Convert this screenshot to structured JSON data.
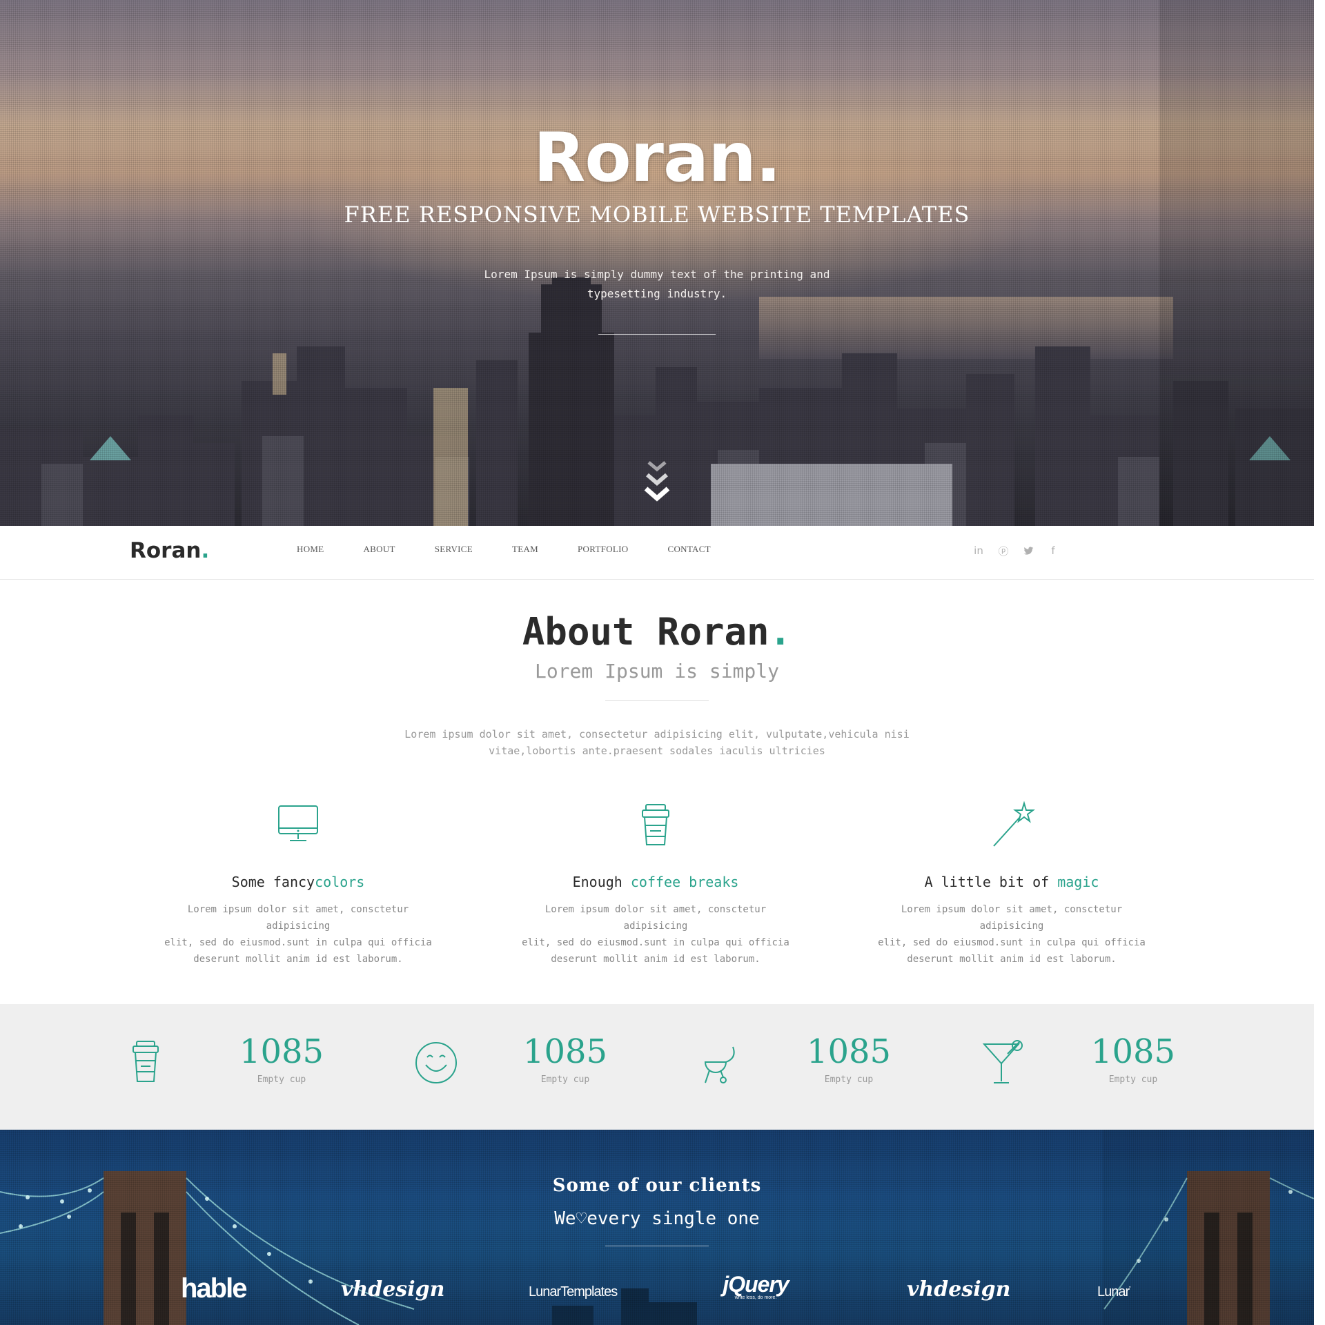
{
  "hero": {
    "title": "Roran",
    "title_dot": ".",
    "subtitle": "FREE RESPONSIVE MOBILE WEBSITE TEMPLATES",
    "text_line1": "Lorem Ipsum is simply dummy text of the printing and",
    "text_line2": "typesetting industry."
  },
  "nav": {
    "logo": "Roran",
    "logo_dot": ".",
    "items": [
      "HOME",
      "ABOUT",
      "SERVICE",
      "TEAM",
      "PORTFOLIO",
      "CONTACT"
    ],
    "social": [
      "linkedin-icon",
      "pinterest-icon",
      "twitter-icon",
      "facebook-icon"
    ]
  },
  "about": {
    "title": "About Roran",
    "title_dot": ".",
    "subtitle": "Lorem Ipsum is simply",
    "text_line1": "Lorem ipsum dolor sit amet, consectetur adipisicing elit, vulputate,vehicula nisi",
    "text_line2": "vitae,lobortis ante.praesent sodales iaculis ultricies",
    "features": [
      {
        "icon": "monitor-icon",
        "title_plain": "Some fancy",
        "title_accent": "colors",
        "text_line1": "Lorem ipsum dolor sit amet, consctetur adipisicing",
        "text_line2": "elit, sed do eiusmod.sunt in culpa qui officia",
        "text_line3": "deserunt mollit anim id est laborum."
      },
      {
        "icon": "coffee-cup-icon",
        "title_plain": "Enough ",
        "title_accent": "coffee breaks",
        "text_line1": "Lorem ipsum dolor sit amet, consctetur adipisicing",
        "text_line2": "elit, sed do eiusmod.sunt in culpa qui officia",
        "text_line3": "deserunt mollit anim id est laborum."
      },
      {
        "icon": "magic-wand-icon",
        "title_plain": "A little bit of ",
        "title_accent": "magic",
        "text_line1": "Lorem ipsum dolor sit amet, consctetur adipisicing",
        "text_line2": "elit, sed do eiusmod.sunt in culpa qui officia",
        "text_line3": "deserunt mollit anim id est laborum."
      }
    ]
  },
  "stats": [
    {
      "icon": "coffee-cup-icon",
      "value": "1085",
      "label": "Empty cup"
    },
    {
      "icon": "smiley-icon",
      "value": "1085",
      "label": "Empty cup"
    },
    {
      "icon": "grill-icon",
      "value": "1085",
      "label": "Empty cup"
    },
    {
      "icon": "cocktail-icon",
      "value": "1085",
      "label": "Empty cup"
    }
  ],
  "clients": {
    "title": "Some of our clients",
    "subtitle": "We♡every single one",
    "logos": [
      "hable",
      "vhdesign",
      "LunarTemplates",
      "jQuery",
      "write less, do more.",
      "vhdesign",
      "LunarTe"
    ]
  },
  "colors": {
    "accent": "#2aa38c",
    "stats_background": "#efefef",
    "clients_background": "#1b4c80"
  }
}
